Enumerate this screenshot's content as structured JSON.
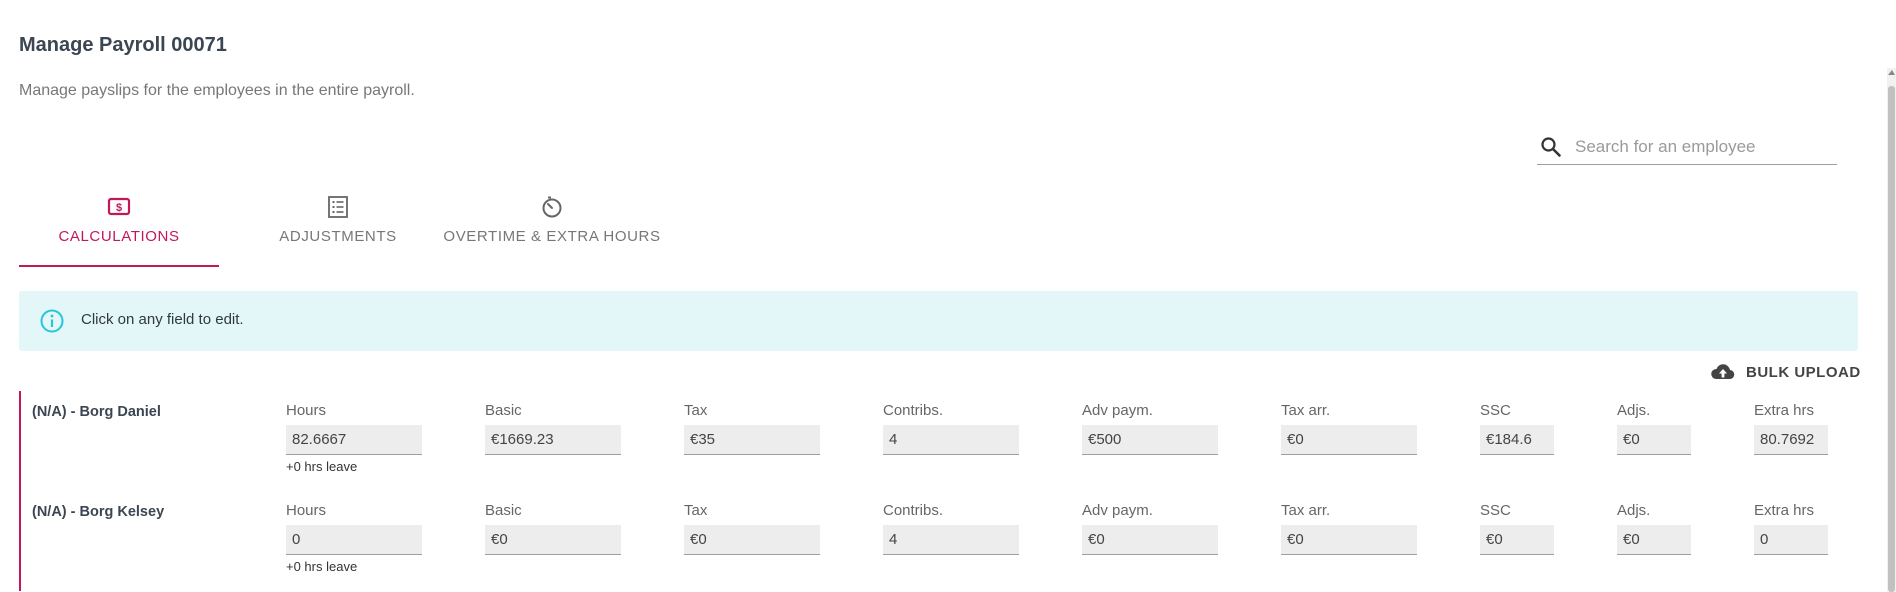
{
  "header": {
    "title": "Manage Payroll 00071",
    "subtitle": "Manage payslips for the employees in the entire payroll."
  },
  "search": {
    "placeholder": "Search for an employee",
    "value": ""
  },
  "tabs": [
    {
      "label": "CALCULATIONS",
      "icon": "dollar-receipt-icon",
      "active": true
    },
    {
      "label": "ADJUSTMENTS",
      "icon": "list-document-icon",
      "active": false
    },
    {
      "label": "OVERTIME & EXTRA HOURS",
      "icon": "clock-icon",
      "active": false
    }
  ],
  "info": {
    "text": "Click on any field to edit.",
    "icon": "info-icon"
  },
  "bulk_upload": {
    "label": "BULK UPLOAD",
    "icon": "cloud-upload-icon"
  },
  "columns": [
    "Hours",
    "Basic",
    "Tax",
    "Contribs.",
    "Adv paym.",
    "Tax arr.",
    "SSC",
    "Adjs.",
    "Extra hrs"
  ],
  "employees": [
    {
      "name": "(N/A) - Borg Daniel",
      "leave_note": "+0 hrs leave",
      "values": [
        "82.6667",
        "€1669.23",
        "€35",
        "4",
        "€500",
        "€0",
        "€184.6",
        "€0",
        "80.7692"
      ]
    },
    {
      "name": "(N/A) - Borg Kelsey",
      "leave_note": "+0 hrs leave",
      "values": [
        "0",
        "€0",
        "€0",
        "4",
        "€0",
        "€0",
        "€0",
        "€0",
        "0"
      ]
    }
  ],
  "colors": {
    "accent": "#c2185b",
    "info_background": "#e3f6f8",
    "info_icon": "#26c6da",
    "field_background": "#ededed"
  }
}
